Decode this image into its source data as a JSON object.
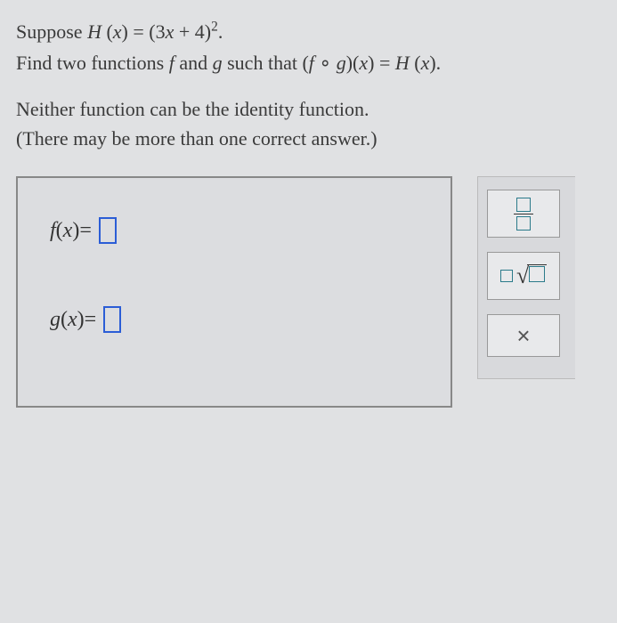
{
  "problem": {
    "line1_prefix": "Suppose ",
    "H": "H",
    "x": "x",
    "eq": " = ",
    "expr_open": "(3",
    "expr_plus": " + 4)",
    "sup": "2",
    "period": ".",
    "line2_a": "Find two functions ",
    "f": "f",
    "line2_b": " and ",
    "g": "g",
    "line2_c": " such that ",
    "comp_open": "(",
    "circ": " ∘ ",
    "comp_close": ")",
    "rhs_eq": " = ",
    "rhs_period": "."
  },
  "instruction": {
    "line1": "Neither function can be the identity function.",
    "line2": "(There may be more than one correct answer.)"
  },
  "answers": {
    "f_label": "f",
    "g_label": "g",
    "arg": "x",
    "eq": " = "
  },
  "toolbar": {
    "frac": "fraction",
    "root": "nth-root",
    "close": "×"
  }
}
